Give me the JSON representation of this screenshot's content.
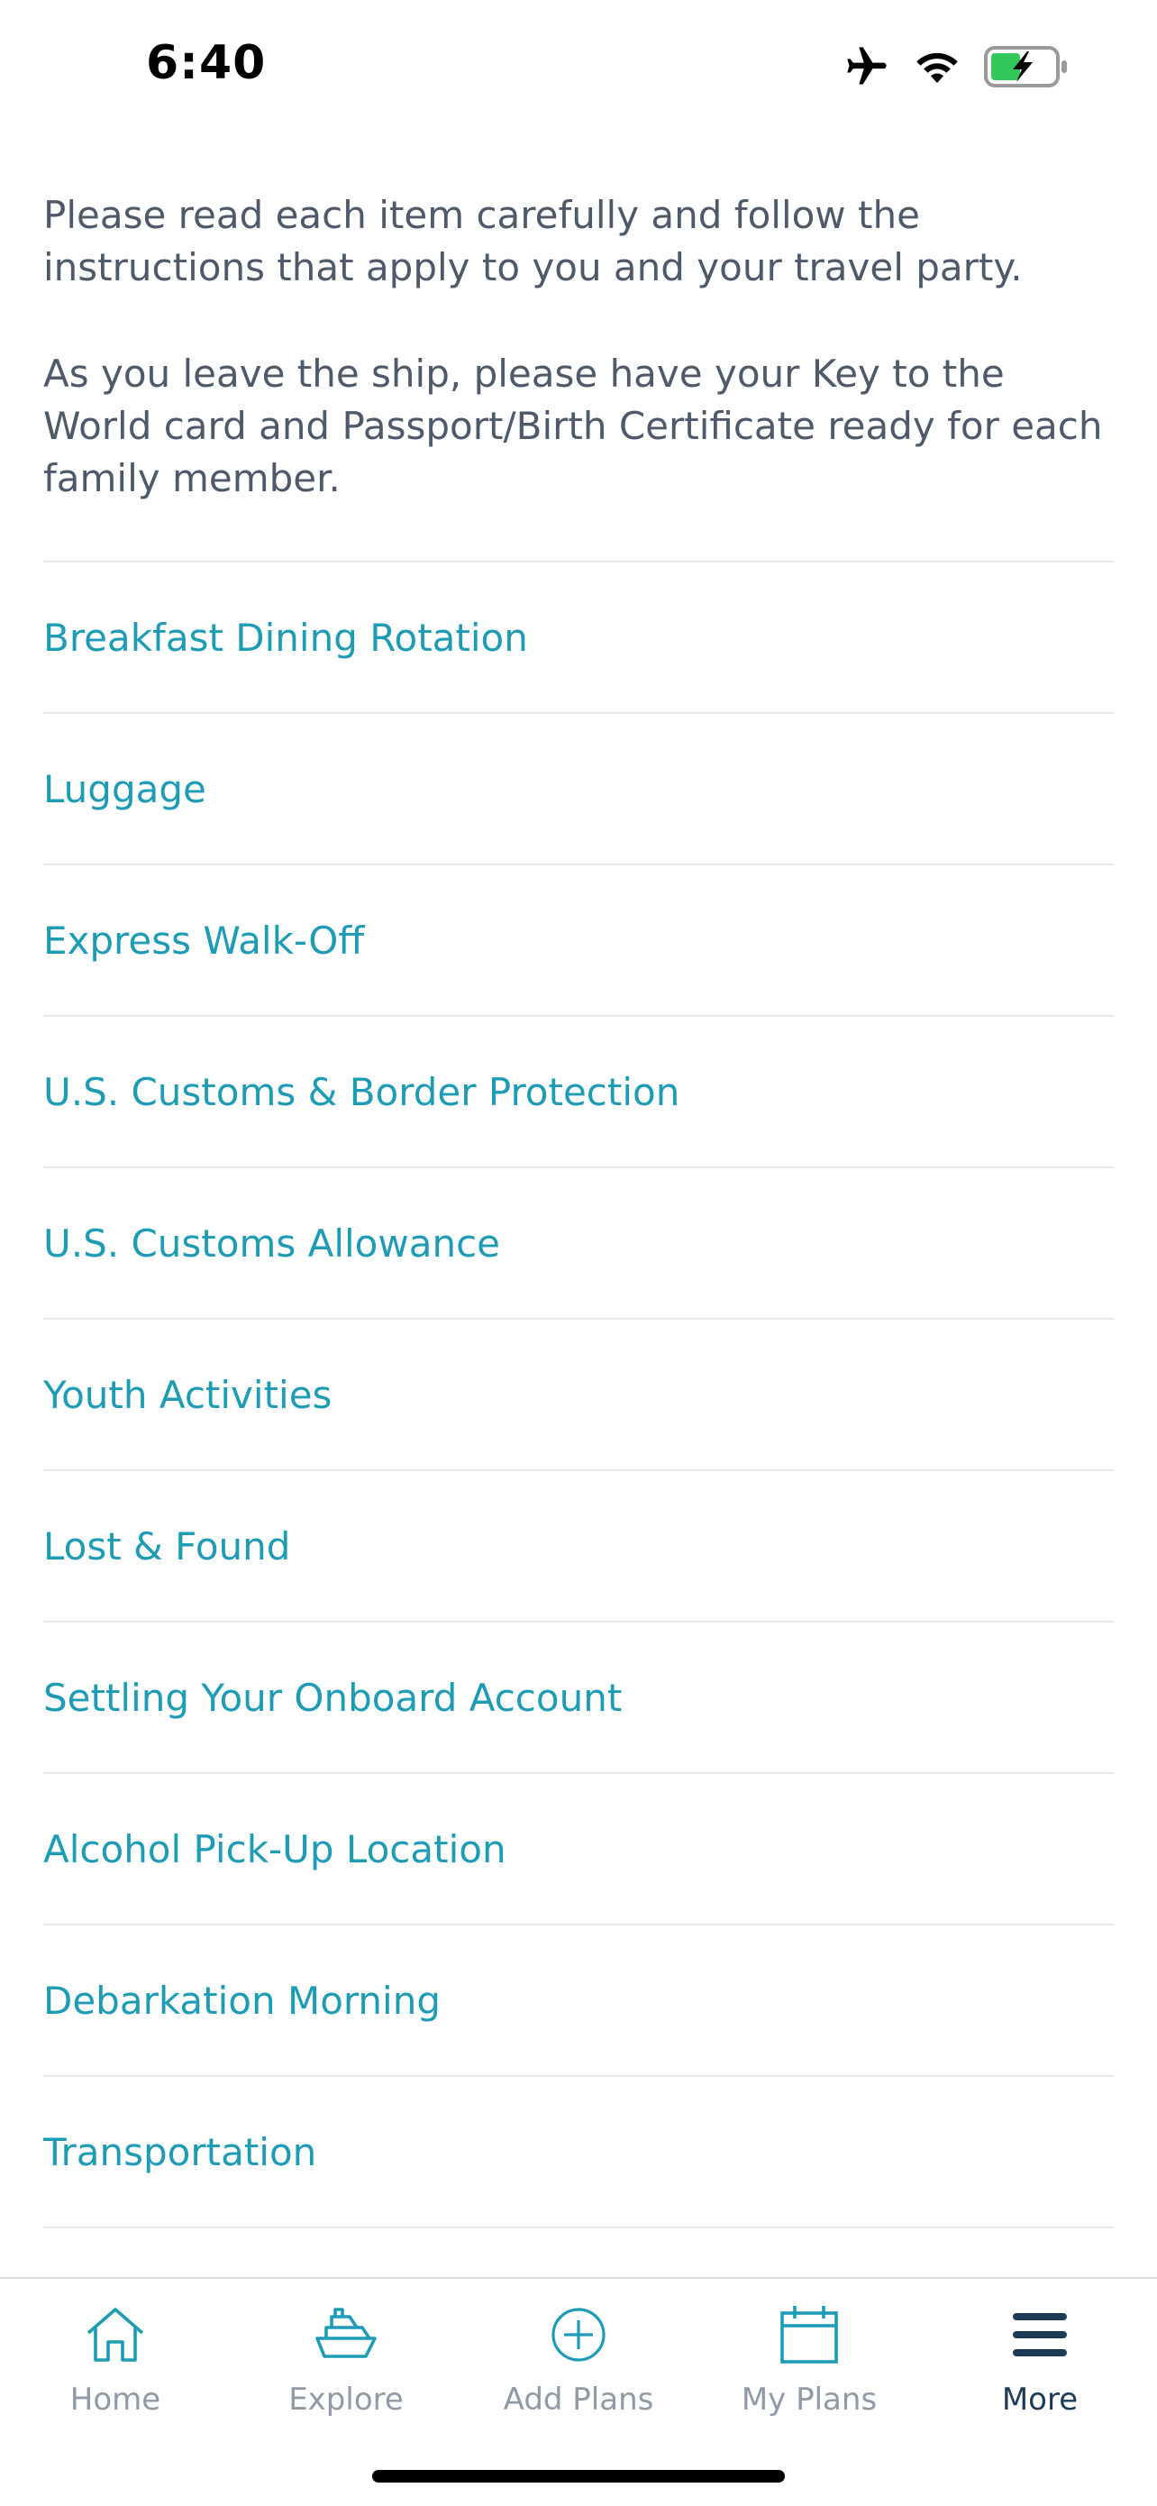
{
  "status_bar": {
    "time": "6:40",
    "icons": [
      "airplane-icon",
      "wifi-icon",
      "battery-charging-icon"
    ],
    "battery_color": "#34c759"
  },
  "intro": {
    "paragraph_1": "Please read each item carefully and follow the instructions that apply to you and your travel party.",
    "paragraph_2": "As you leave the ship, please have your Key to the World card and Passport/Birth Certificate ready for each family member."
  },
  "sections": [
    {
      "label": "Breakfast Dining Rotation"
    },
    {
      "label": "Luggage"
    },
    {
      "label": "Express Walk-Off"
    },
    {
      "label": "U.S. Customs & Border Protection"
    },
    {
      "label": "U.S. Customs Allowance"
    },
    {
      "label": "Youth Activities"
    },
    {
      "label": "Lost & Found"
    },
    {
      "label": "Settling Your Onboard Account"
    },
    {
      "label": "Alcohol Pick-Up Location"
    },
    {
      "label": "Debarkation Morning"
    },
    {
      "label": "Transportation"
    }
  ],
  "tabbar": {
    "tabs": [
      {
        "label": "Home",
        "icon": "home-icon"
      },
      {
        "label": "Explore",
        "icon": "ship-icon"
      },
      {
        "label": "Add Plans",
        "icon": "plus-circle-icon"
      },
      {
        "label": "My Plans",
        "icon": "calendar-icon"
      },
      {
        "label": "More",
        "icon": "menu-icon",
        "active": true
      }
    ],
    "active_color": "#1d3b56",
    "inactive_color": "#8f9aa6",
    "icon_color": "#1e9bb5"
  },
  "colors": {
    "link": "#1e9bb5",
    "body_text": "#4e5a6a",
    "divider": "#e6e9ec"
  }
}
